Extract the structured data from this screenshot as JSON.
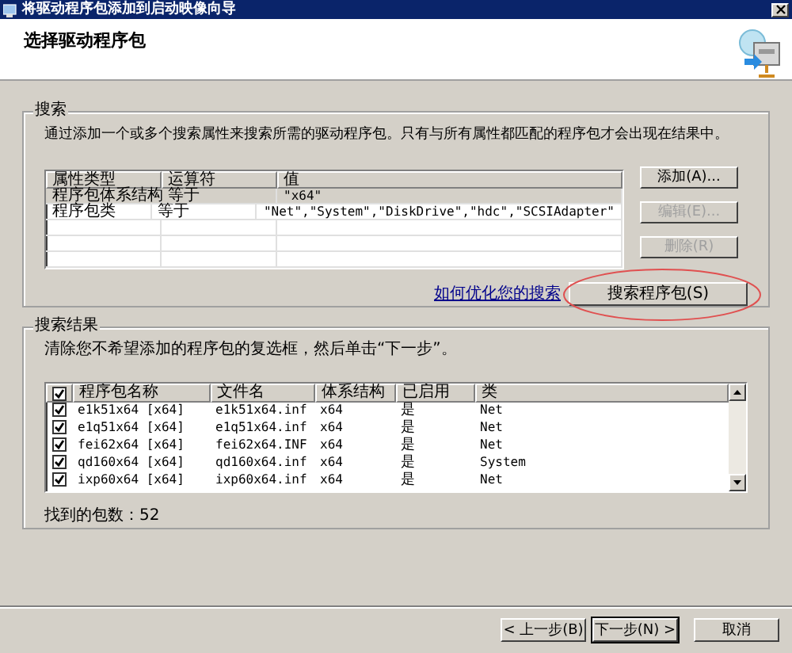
{
  "window": {
    "title": "将驱动程序包添加到启动映像向导"
  },
  "header": {
    "title": "选择驱动程序包"
  },
  "search": {
    "group_label": "搜索",
    "description": "通过添加一个或多个搜索属性来搜索所需的驱动程序包。只有与所有属性都匹配的程序包才会出现在结果中。",
    "columns": [
      "属性类型",
      "运算符",
      "值"
    ],
    "rows": [
      {
        "cells": [
          "程序包体系结构",
          "等于",
          "\"x64\""
        ],
        "selected": true
      },
      {
        "cells": [
          "程序包类",
          "等于",
          "\"Net\",\"System\",\"DiskDrive\",\"hdc\",\"SCSIAdapter\""
        ],
        "selected": false
      }
    ],
    "buttons": [
      {
        "label": "添加(A)...",
        "disabled": false
      },
      {
        "label": "编辑(E)...",
        "disabled": true
      },
      {
        "label": "删除(R)",
        "disabled": true
      }
    ],
    "link": "如何优化您的搜索",
    "search_button": "搜索程序包(S)"
  },
  "results": {
    "group_label": "搜索结果",
    "description": "清除您不希望添加的程序包的复选框，然后单击“下一步”。",
    "header_checked": true,
    "columns": [
      "程序包名称",
      "文件名",
      "体系结构",
      "已启用",
      "类"
    ],
    "rows": [
      {
        "checked": true,
        "cells": [
          "e1k51x64 [x64]",
          "e1k51x64.inf",
          "x64",
          "是",
          "Net"
        ]
      },
      {
        "checked": true,
        "cells": [
          "e1q51x64 [x64]",
          "e1q51x64.inf",
          "x64",
          "是",
          "Net"
        ]
      },
      {
        "checked": true,
        "cells": [
          "fei62x64 [x64]",
          "fei62x64.INF",
          "x64",
          "是",
          "Net"
        ]
      },
      {
        "checked": true,
        "cells": [
          "qd160x64 [x64]",
          "qd160x64.inf",
          "x64",
          "是",
          "System"
        ]
      },
      {
        "checked": true,
        "cells": [
          "ixp60x64 [x64]",
          "ixp60x64.inf",
          "x64",
          "是",
          "Net"
        ]
      }
    ],
    "count": "找到的包数：52"
  },
  "footer": {
    "buttons": [
      {
        "label": "< 上一步(B)",
        "default": false
      },
      {
        "label": "下一步(N) >",
        "default": true
      },
      {
        "label": "取消",
        "default": false
      }
    ]
  }
}
